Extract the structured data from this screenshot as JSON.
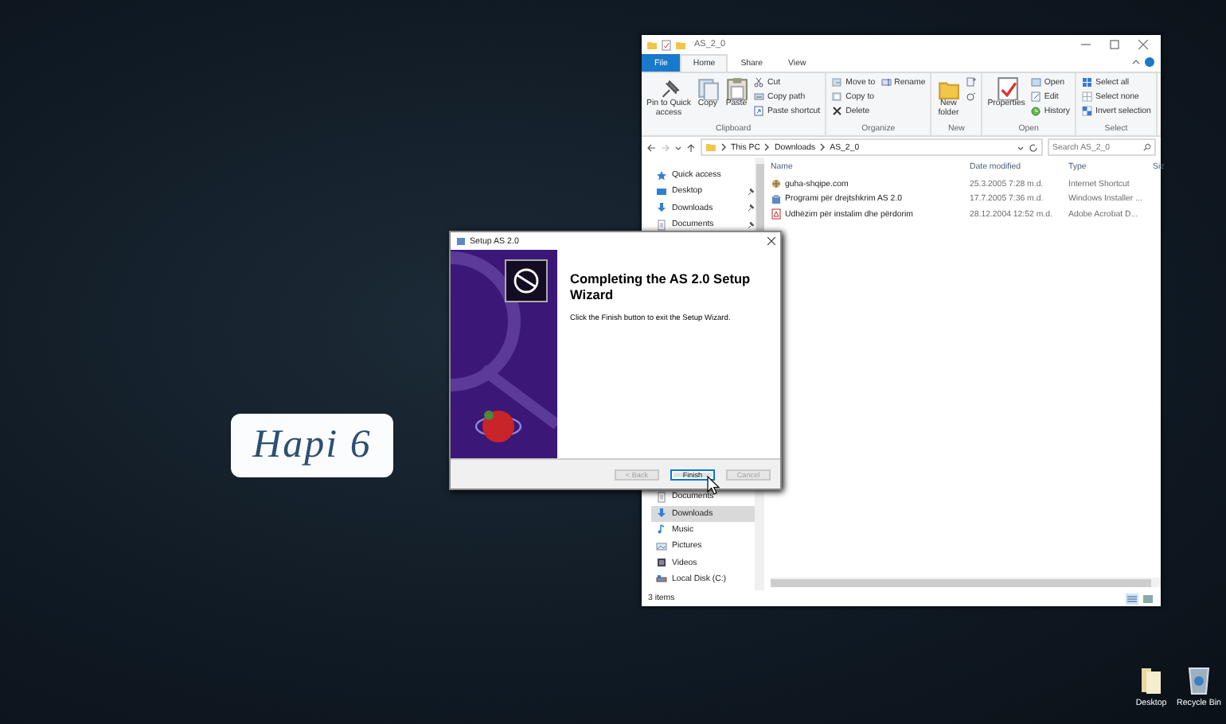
{
  "step_label": "Hapi 6",
  "explorer": {
    "title": "AS_2_0",
    "tabs": [
      {
        "label": "File",
        "kind": "file",
        "selected": false
      },
      {
        "label": "Home",
        "kind": "tab",
        "selected": true
      },
      {
        "label": "Share",
        "kind": "tab",
        "selected": false
      },
      {
        "label": "View",
        "kind": "tab",
        "selected": false
      }
    ],
    "ribbon": [
      {
        "label": "Clipboard",
        "items": [
          {
            "lines": [
              "Pin to Quick",
              "access"
            ],
            "kind": "pin",
            "large": true
          },
          {
            "lines": [
              "Copy"
            ],
            "kind": "copy",
            "large": true
          },
          {
            "lines": [
              "Paste"
            ],
            "kind": "paste",
            "large": true
          },
          {
            "lines": [
              "Cut"
            ],
            "kind": "cut",
            "large": false
          },
          {
            "lines": [
              "Copy path"
            ],
            "kind": "copy-path",
            "large": false
          },
          {
            "lines": [
              "Paste shortcut"
            ],
            "kind": "paste-shortcut",
            "large": false
          }
        ]
      },
      {
        "label": "Organize",
        "items": [
          {
            "lines": [
              "Move to"
            ],
            "kind": "move",
            "large": false
          },
          {
            "lines": [
              "Copy to"
            ],
            "kind": "copy-to",
            "large": false
          },
          {
            "lines": [
              "Delete"
            ],
            "kind": "delete",
            "large": false
          },
          {
            "lines": [
              "Rename"
            ],
            "kind": "rename",
            "large": false
          }
        ]
      },
      {
        "label": "New",
        "items": [
          {
            "lines": [
              "New",
              "folder"
            ],
            "kind": "new-folder",
            "large": true
          },
          {
            "kind": "new-item",
            "large": false
          },
          {
            "kind": "easy-access",
            "large": false
          }
        ]
      },
      {
        "label": "Open",
        "items": [
          {
            "lines": [
              "Properties"
            ],
            "kind": "properties",
            "large": true
          },
          {
            "lines": [
              "Open"
            ],
            "kind": "open",
            "large": false
          },
          {
            "lines": [
              "Edit"
            ],
            "kind": "edit",
            "large": false
          },
          {
            "lines": [
              "History"
            ],
            "kind": "history",
            "large": false
          }
        ]
      },
      {
        "label": "Select",
        "items": [
          {
            "lines": [
              "Select all"
            ],
            "kind": "select-all",
            "large": false
          },
          {
            "lines": [
              "Select none"
            ],
            "kind": "select-none",
            "large": false
          },
          {
            "lines": [
              "Invert selection"
            ],
            "kind": "invert",
            "large": false
          }
        ]
      }
    ],
    "breadcrumbs": [
      "This PC",
      "Downloads",
      "AS_2_0"
    ],
    "search": {
      "placeholder": "Search AS_2_0"
    },
    "nav_top": [
      {
        "label": "Quick access",
        "kind": "star",
        "pinned": false,
        "selected": false
      },
      {
        "label": "Desktop",
        "kind": "desktop",
        "pinned": true,
        "selected": false
      },
      {
        "label": "Downloads",
        "kind": "downloads",
        "pinned": true,
        "selected": false
      },
      {
        "label": "Documents",
        "kind": "documents",
        "pinned": true,
        "selected": false
      }
    ],
    "nav_bottom": [
      {
        "label": "Documents",
        "kind": "documents",
        "pinned": false,
        "selected": false
      },
      {
        "label": "Downloads",
        "kind": "downloads",
        "pinned": false,
        "selected": true
      },
      {
        "label": "Music",
        "kind": "music",
        "pinned": false,
        "selected": false
      },
      {
        "label": "Pictures",
        "kind": "pictures",
        "pinned": false,
        "selected": false
      },
      {
        "label": "Videos",
        "kind": "videos",
        "pinned": false,
        "selected": false
      },
      {
        "label": "Local Disk (C:)",
        "kind": "disk",
        "pinned": false,
        "selected": false
      }
    ],
    "columns": [
      "Name",
      "Date modified",
      "Type",
      "Siz"
    ],
    "rows": [
      {
        "name": "guha-shqipe.com",
        "date": "25.3.2005 7:28 m.d.",
        "type": "Internet Shortcut",
        "kind": "link"
      },
      {
        "name": "Programi për drejtshkrim AS 2.0",
        "date": "17.7.2005 7:36 m.d.",
        "type": "Windows Installer ...",
        "kind": "installer"
      },
      {
        "name": "Udhëzim për instalim dhe përdorim",
        "date": "28.12.2004 12:52 m.d.",
        "type": "Adobe Acrobat D...",
        "kind": "pdf"
      }
    ],
    "status": "3 items"
  },
  "dialog": {
    "title": "Setup AS 2.0",
    "heading": "Completing the AS 2.0 Setup Wizard",
    "message": "Click the Finish button to exit the Setup Wizard.",
    "buttons": [
      {
        "label": "< Back",
        "disabled": true,
        "focused": false
      },
      {
        "label": "Finish",
        "disabled": false,
        "focused": true
      },
      {
        "label": "Cancel",
        "disabled": true,
        "focused": false
      }
    ]
  },
  "desktop_icons": [
    {
      "label": "Desktop",
      "kind": "folder"
    },
    {
      "label": "Recycle Bin",
      "kind": "bin"
    }
  ]
}
